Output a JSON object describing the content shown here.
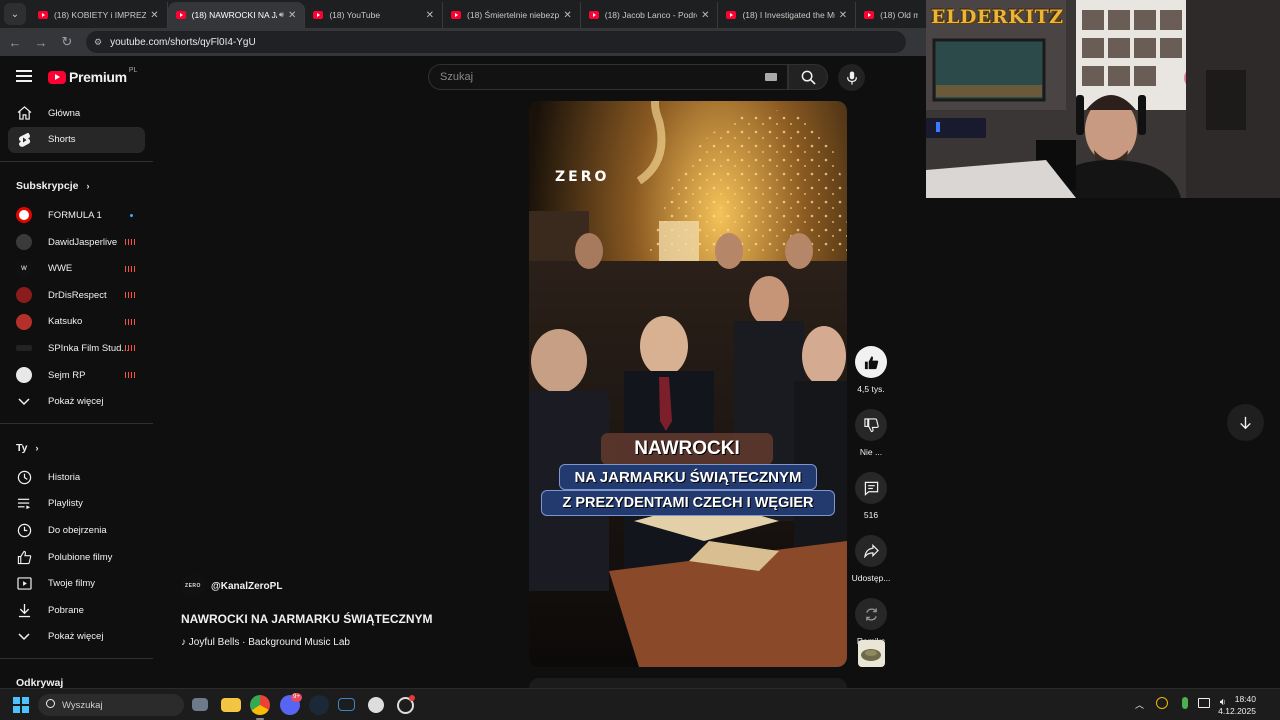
{
  "browser": {
    "tabs": [
      {
        "title": "(18) KOBIETY i IMPREZY w",
        "active": false
      },
      {
        "title": "(18) NAWROCKI NA JA",
        "active": true,
        "audio": true
      },
      {
        "title": "(18) YouTube",
        "active": false
      },
      {
        "title": "(18) Śmiertelnie niebezpie",
        "active": false
      },
      {
        "title": "(18) Jacob Lanco - Podróż",
        "active": false
      },
      {
        "title": "(18) I Investigated the Mu",
        "active": false
      },
      {
        "title": "(18) Old man",
        "active": false
      }
    ],
    "url": "youtube.com/shorts/qyFl0I4-YgU"
  },
  "youtube": {
    "logo_text": "Premium",
    "logo_region": "PL",
    "search_placeholder": "Szukaj",
    "sidebar": {
      "main": [
        {
          "label": "Główna",
          "icon": "home-icon",
          "active": false
        },
        {
          "label": "Shorts",
          "icon": "shorts-icon",
          "active": true
        }
      ],
      "subs_heading": "Subskrypcje",
      "subscriptions": [
        {
          "label": "FORMULA 1",
          "indicator": "dot",
          "color": "#e10600"
        },
        {
          "label": "DawidJasperlive",
          "indicator": "live",
          "color": "#3a3a3a"
        },
        {
          "label": "WWE",
          "indicator": "live",
          "color": "#111111"
        },
        {
          "label": "DrDisRespect",
          "indicator": "live",
          "color": "#8a1c1c"
        },
        {
          "label": "Katsuko",
          "indicator": "live",
          "color": "#b5302a"
        },
        {
          "label": "SPInka Film Stud...",
          "indicator": "live",
          "color": "#222222"
        },
        {
          "label": "Sejm RP",
          "indicator": "live",
          "color": "#e8e8e8"
        }
      ],
      "subs_more": "Pokaż więcej",
      "you_heading": "Ty",
      "you_items": [
        {
          "label": "Historia",
          "icon": "history-icon"
        },
        {
          "label": "Playlisty",
          "icon": "playlist-icon"
        },
        {
          "label": "Do obejrzenia",
          "icon": "watch-later-icon"
        },
        {
          "label": "Polubione filmy",
          "icon": "thumb-up-icon"
        },
        {
          "label": "Twoje filmy",
          "icon": "your-videos-icon"
        },
        {
          "label": "Pobrane",
          "icon": "download-icon"
        }
      ],
      "you_more": "Pokaż więcej",
      "explore_heading": "Odkrywaj"
    },
    "short": {
      "channel": "@KanalZeroPL",
      "channel_avatar_text": "ZERO",
      "title": "NAWROCKI NA JARMARKU ŚWIĄTECZNYM",
      "music": "♪ Joyful Bells · Background Music Lab",
      "overlay_brand": "ZERO",
      "caption_line1": "NAWROCKI",
      "caption_line2": "NA JARMARKU ŚWIĄTECZNYM",
      "caption_line3": "Z PREZYDENTAMI CZECH I WĘGIER",
      "likes": "4,5 tys.",
      "dislike_label": "Nie ...",
      "comments": "516",
      "share_label": "Udostęp...",
      "remix_label": "Remiks"
    }
  },
  "stream_overlay": {
    "logo_text": "ELDERKITZ"
  },
  "taskbar": {
    "search_placeholder": "Wyszukaj",
    "time": "18:40",
    "date": "4.12.2025",
    "discord_badge": "9+"
  }
}
